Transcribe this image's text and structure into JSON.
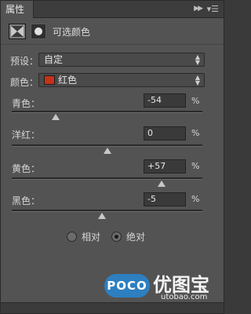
{
  "tab": {
    "label": "属性",
    "close_glyph": "×"
  },
  "header": {
    "title": "可选颜色"
  },
  "preset": {
    "label": "预设：",
    "value": "自定"
  },
  "colors": {
    "label": "颜色：",
    "value": "红色",
    "swatch": "#c4321a"
  },
  "sliders": [
    {
      "label": "青色：",
      "value": "-54",
      "unit": "%",
      "level": -54
    },
    {
      "label": "洋红：",
      "value": "0",
      "unit": "%",
      "level": 0
    },
    {
      "label": "黄色：",
      "value": "+57",
      "unit": "%",
      "level": 57
    },
    {
      "label": "黑色：",
      "value": "-5",
      "unit": "%",
      "level": -5
    }
  ],
  "method": {
    "options": [
      {
        "label": "相对",
        "selected": false
      },
      {
        "label": "绝对",
        "selected": true
      }
    ]
  },
  "watermark": {
    "badge": "POCO",
    "brand": "优图宝",
    "url": "utobao.com"
  }
}
